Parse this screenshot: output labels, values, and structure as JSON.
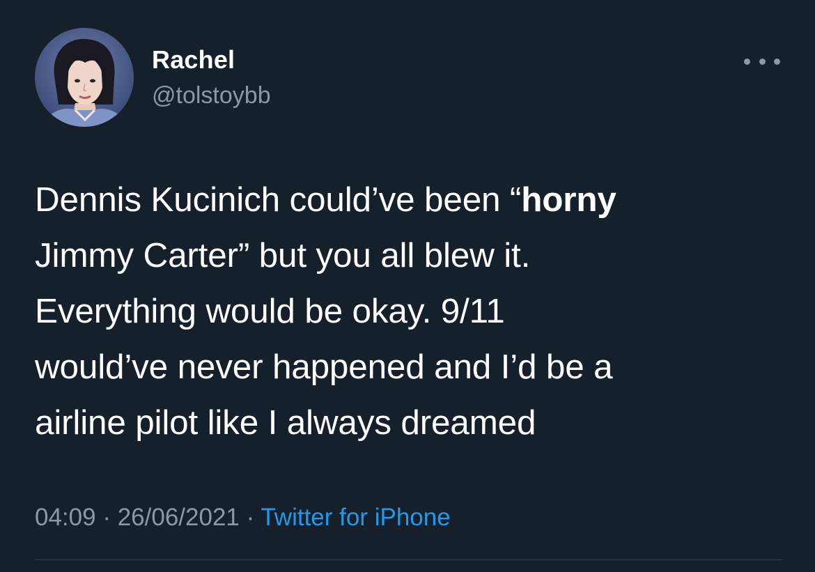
{
  "tweet": {
    "author": {
      "display_name": "Rachel",
      "handle": "@tolstoybb",
      "avatar_icon": "avatar-portrait-icon"
    },
    "more_icon": "more-options-icon",
    "text": {
      "line1_before_bold": "Dennis Kucinich could’ve been “",
      "line1_bold": "horny",
      "line2": "Jimmy Carter” but you all blew it.",
      "line3": "Everything would be okay. 9/11",
      "line4": "would’ve never happened and I’d be a",
      "line5": "airline pilot like I always dreamed"
    },
    "meta": {
      "time": "04:09",
      "separator1": " · ",
      "date": "26/06/2021",
      "separator2": " · ",
      "source": "Twitter for iPhone"
    }
  },
  "colors": {
    "background": "#15202b",
    "text_primary": "#ffffff",
    "text_secondary": "#8b98a5",
    "link": "#1d9bf0",
    "divider": "#38444d"
  }
}
